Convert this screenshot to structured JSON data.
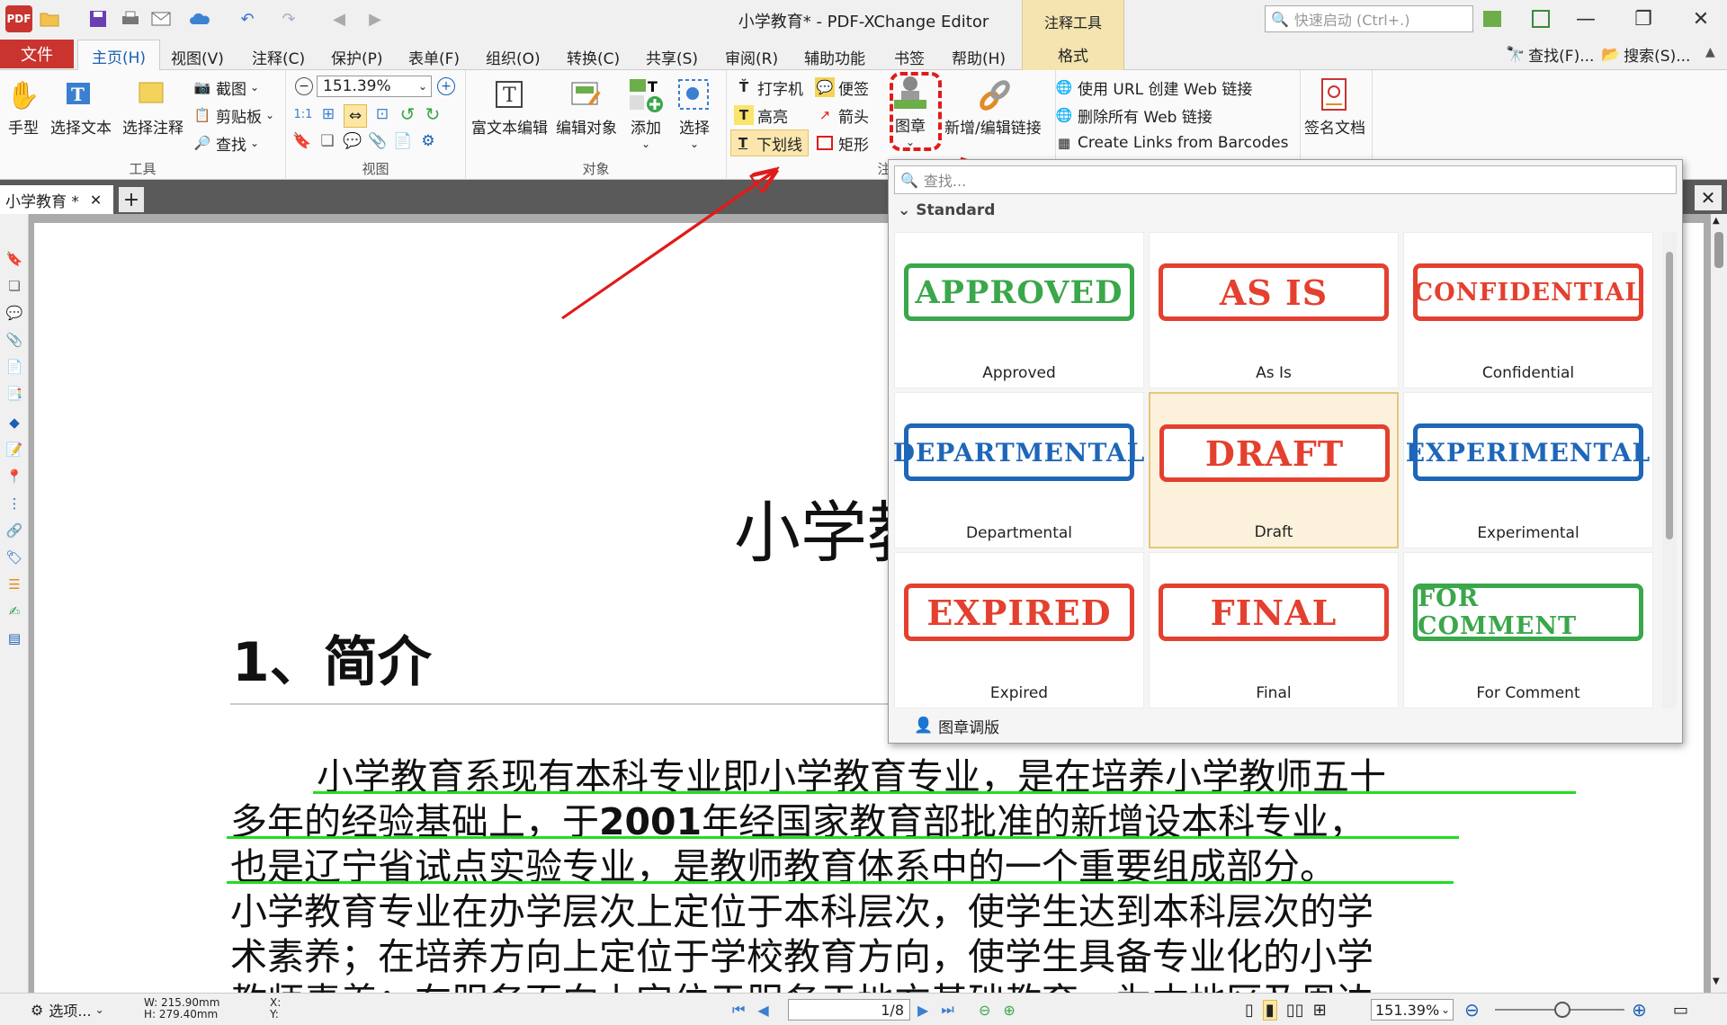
{
  "window": {
    "title": "小学教育* - PDF-XChange Editor",
    "context_group": "注释工具",
    "context_tab": "格式",
    "quick_launch_placeholder": "快速启动 (Ctrl+.)"
  },
  "menu_tabs": [
    "文件",
    "主页(H)",
    "视图(V)",
    "注释(C)",
    "保护(P)",
    "表单(F)",
    "组织(O)",
    "转换(C)",
    "共享(S)",
    "审阅(R)",
    "辅助功能",
    "书签",
    "帮助(H)"
  ],
  "right_tools": {
    "find": "查找(F)...",
    "search": "搜索(S)..."
  },
  "ribbon": {
    "tools": {
      "hand": "手型",
      "select_text": "选择文本",
      "select_comment": "选择注释",
      "screenshot": "截图",
      "clipboard": "剪贴板",
      "find": "查找",
      "label": "工具"
    },
    "view": {
      "zoom": "151.39%",
      "label": "视图"
    },
    "objects": {
      "rich_text": "富文本编辑",
      "edit_object": "编辑对象",
      "add": "添加",
      "select": "选择",
      "label": "对象"
    },
    "comments": {
      "typewriter": "打字机",
      "note": "便签",
      "highlight": "高亮",
      "arrow": "箭头",
      "underline": "下划线",
      "rectangle": "矩形",
      "stamp": "图章",
      "label": "注释"
    },
    "links": {
      "add_edit": "新增/编辑链接",
      "create_url": "使用 URL 创建 Web 链接",
      "delete_all": "删除所有 Web 链接",
      "from_barcodes": "Create Links from Barcodes"
    },
    "sign": {
      "sign_doc": "签名文档"
    }
  },
  "doc_tab": {
    "name": "小学教育 *"
  },
  "stamp_popup": {
    "search_placeholder": "查找...",
    "category": "Standard",
    "stamps": [
      {
        "text": "APPROVED",
        "name": "Approved",
        "color": "green"
      },
      {
        "text": "AS IS",
        "name": "As Is",
        "color": "red"
      },
      {
        "text": "CONFIDENTIAL",
        "name": "Confidential",
        "color": "red"
      },
      {
        "text": "DEPARTMENTAL",
        "name": "Departmental",
        "color": "blue"
      },
      {
        "text": "DRAFT",
        "name": "Draft",
        "color": "red",
        "selected": true
      },
      {
        "text": "EXPERIMENTAL",
        "name": "Experimental",
        "color": "blue"
      },
      {
        "text": "EXPIRED",
        "name": "Expired",
        "color": "red"
      },
      {
        "text": "FINAL",
        "name": "Final",
        "color": "red"
      },
      {
        "text": "FOR COMMENT",
        "name": "For Comment",
        "color": "green"
      }
    ],
    "footer": "图章调版"
  },
  "document": {
    "title_fragment": "小学教",
    "heading": "1、简介",
    "lines": [
      [
        {
          "t": "小学教育系现有本科专业即"
        },
        {
          "t": "小学教育专业",
          "link": true
        },
        {
          "t": "，是在培养"
        },
        {
          "t": "小学教师",
          "link": true
        },
        {
          "t": "五十"
        }
      ],
      [
        {
          "t": "多年的经验基础上，于"
        },
        {
          "t": "2001",
          "bold": true
        },
        {
          "t": "年经国家教育部批准的新增设本科专业，"
        }
      ],
      [
        {
          "t": "也是"
        },
        {
          "t": "辽宁省",
          "link": true
        },
        {
          "t": "试点实验专业，是"
        },
        {
          "t": "教师教育",
          "link": true
        },
        {
          "t": "体系中的一个重要组成部分。"
        }
      ],
      [
        {
          "t": "小学教育专业在办学层次上定位于本科层次，使学生达到本科层次的学"
        }
      ],
      [
        {
          "t": "术素养；在培养方向上定位于"
        },
        {
          "t": "学校教育",
          "link": true
        },
        {
          "t": "方向，使学生具备专业化的小学"
        }
      ],
      [
        {
          "t": "教师素养；在服务面向上定位于服务于地方"
        },
        {
          "t": "基础教育",
          "link": true
        },
        {
          "t": "，为本地区及周边"
        }
      ]
    ]
  },
  "statusbar": {
    "options": "选项...",
    "width": "W: 215.90mm",
    "height": "H: 279.40mm",
    "x": "X:",
    "y": "Y:",
    "page": "1/8",
    "zoom": "151.39%"
  },
  "colors": {
    "file_tab": "#c9342f",
    "accent": "#1a5fb4",
    "underline": "#22dd22",
    "highlight_box": "#e01b1b",
    "arrow": "#e01b1b",
    "context_tab": "#f3e4b0"
  }
}
